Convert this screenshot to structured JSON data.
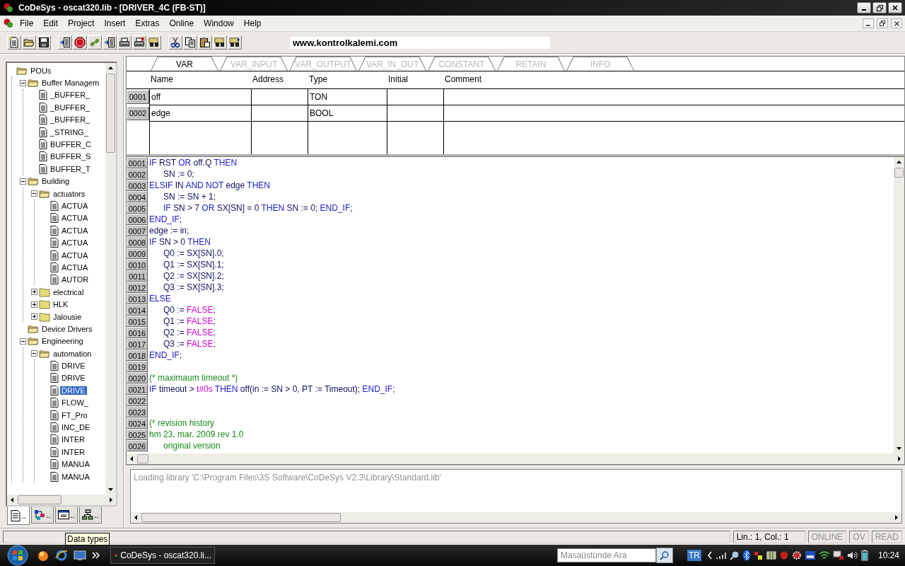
{
  "window": {
    "title": "CoDeSys - oscat320.lib - [DRIVER_4C (FB-ST)]"
  },
  "menu": [
    "File",
    "Edit",
    "Project",
    "Insert",
    "Extras",
    "Online",
    "Window",
    "Help"
  ],
  "toolbar": {
    "banner": "www.kontrolkalemi.com"
  },
  "tree": [
    {
      "label": "POUs",
      "kind": "folder",
      "selected": false,
      "children": [
        {
          "label": "Buffer Managem",
          "kind": "folder",
          "expanded": true,
          "selected": false,
          "children": [
            {
              "label": "_BUFFER_",
              "kind": "doc",
              "selected": false
            },
            {
              "label": "_BUFFER_",
              "kind": "doc",
              "selected": false
            },
            {
              "label": "_BUFFER_",
              "kind": "doc",
              "selected": false
            },
            {
              "label": "_STRING_",
              "kind": "doc",
              "selected": false
            },
            {
              "label": "BUFFER_C",
              "kind": "doc",
              "selected": false
            },
            {
              "label": "BUFFER_S",
              "kind": "doc",
              "selected": false
            },
            {
              "label": "BUFFER_T",
              "kind": "doc",
              "selected": false
            }
          ]
        },
        {
          "label": "Building",
          "kind": "folder",
          "expanded": true,
          "selected": false,
          "children": [
            {
              "label": "actuators",
              "kind": "folder",
              "expanded": true,
              "selected": false,
              "children": [
                {
                  "label": "ACTUA",
                  "kind": "doc",
                  "selected": false
                },
                {
                  "label": "ACTUA",
                  "kind": "doc",
                  "selected": false
                },
                {
                  "label": "ACTUA",
                  "kind": "doc",
                  "selected": false
                },
                {
                  "label": "ACTUA",
                  "kind": "doc",
                  "selected": false
                },
                {
                  "label": "ACTUA",
                  "kind": "doc",
                  "selected": false
                },
                {
                  "label": "ACTUA",
                  "kind": "doc",
                  "selected": false
                },
                {
                  "label": "AUTOR",
                  "kind": "doc",
                  "selected": false
                }
              ]
            },
            {
              "label": "electrical",
              "kind": "folder",
              "expanded": false,
              "selected": false
            },
            {
              "label": "HLK",
              "kind": "folder",
              "expanded": false,
              "selected": false
            },
            {
              "label": "Jalousie",
              "kind": "folder",
              "expanded": false,
              "selected": false
            }
          ]
        },
        {
          "label": "Device Drivers",
          "kind": "folder",
          "selected": false
        },
        {
          "label": "Engineering",
          "kind": "folder",
          "expanded": true,
          "selected": false,
          "children": [
            {
              "label": "automation",
              "kind": "folder",
              "expanded": true,
              "selected": false,
              "children": [
                {
                  "label": "DRIVE",
                  "kind": "doc",
                  "selected": false
                },
                {
                  "label": "DRIVE",
                  "kind": "doc",
                  "selected": false
                },
                {
                  "label": "DRIVE",
                  "kind": "doc",
                  "selected": true
                },
                {
                  "label": "FLOW_",
                  "kind": "doc",
                  "selected": false
                },
                {
                  "label": "FT_Pro",
                  "kind": "doc",
                  "selected": false
                },
                {
                  "label": "INC_DE",
                  "kind": "doc",
                  "selected": false
                },
                {
                  "label": "INTER",
                  "kind": "doc",
                  "selected": false
                },
                {
                  "label": "INTER",
                  "kind": "doc",
                  "selected": false
                },
                {
                  "label": "MANUA",
                  "kind": "doc",
                  "selected": false
                },
                {
                  "label": "MANUA",
                  "kind": "doc",
                  "selected": false
                }
              ]
            }
          ]
        }
      ]
    }
  ],
  "tree_tabs": [
    {
      "label": "..",
      "selected": true
    },
    {
      "label": "..",
      "selected": false
    },
    {
      "label": "..",
      "selected": false
    },
    {
      "label": "..",
      "selected": false
    }
  ],
  "tooltip": "Data types",
  "var_tabs": [
    {
      "label": "VAR",
      "selected": true
    },
    {
      "label": "VAR_INPUT",
      "selected": false
    },
    {
      "label": "VAR_OUTPUT",
      "selected": false
    },
    {
      "label": "VAR_IN_OUT",
      "selected": false
    },
    {
      "label": "CONSTANT",
      "selected": false
    },
    {
      "label": "RETAIN",
      "selected": false
    },
    {
      "label": "INFO",
      "selected": false
    }
  ],
  "var_table": {
    "columns": [
      "Name",
      "Address",
      "Type",
      "Initial",
      "Comment"
    ],
    "rows": [
      {
        "line": "0001",
        "name": "off",
        "type": "TON"
      },
      {
        "line": "0002",
        "name": "edge",
        "type": "BOOL"
      }
    ]
  },
  "code": [
    {
      "line": "0001",
      "indented": false,
      "parts": [
        {
          "kind": "kw",
          "t": "IF"
        },
        {
          "kind": "id",
          "t": " RST "
        },
        {
          "kind": "kw",
          "t": "OR"
        },
        {
          "kind": "id",
          "t": " off.Q "
        },
        {
          "kind": "kw",
          "t": "THEN"
        }
      ]
    },
    {
      "line": "0002",
      "indented": true,
      "parts": [
        {
          "kind": "id",
          "t": "SN := 0;"
        }
      ]
    },
    {
      "line": "0003",
      "indented": false,
      "parts": [
        {
          "kind": "kw",
          "t": "ELSIF"
        },
        {
          "kind": "id",
          "t": " IN "
        },
        {
          "kind": "kw",
          "t": "AND NOT"
        },
        {
          "kind": "id",
          "t": " edge "
        },
        {
          "kind": "kw",
          "t": "THEN"
        }
      ]
    },
    {
      "line": "0004",
      "indented": true,
      "parts": [
        {
          "kind": "id",
          "t": "SN := SN + 1;"
        }
      ]
    },
    {
      "line": "0005",
      "indented": true,
      "parts": [
        {
          "kind": "kw",
          "t": "IF"
        },
        {
          "kind": "id",
          "t": " SN > 7 "
        },
        {
          "kind": "kw",
          "t": "OR"
        },
        {
          "kind": "id",
          "t": " SX[SN] = 0 "
        },
        {
          "kind": "kw",
          "t": "THEN"
        },
        {
          "kind": "id",
          "t": " SN := 0; "
        },
        {
          "kind": "kw",
          "t": "END_IF"
        },
        {
          "kind": "id",
          "t": ";"
        }
      ]
    },
    {
      "line": "0006",
      "indented": false,
      "parts": [
        {
          "kind": "kw",
          "t": "END_IF"
        },
        {
          "kind": "id",
          "t": ";"
        }
      ]
    },
    {
      "line": "0007",
      "indented": false,
      "parts": [
        {
          "kind": "id",
          "t": "edge := in;"
        }
      ]
    },
    {
      "line": "0008",
      "indented": false,
      "parts": [
        {
          "kind": "kw",
          "t": "IF"
        },
        {
          "kind": "id",
          "t": " SN > 0 "
        },
        {
          "kind": "kw",
          "t": "THEN"
        }
      ]
    },
    {
      "line": "0009",
      "indented": true,
      "parts": [
        {
          "kind": "id",
          "t": "Q0 := SX[SN].0;"
        }
      ]
    },
    {
      "line": "0010",
      "indented": true,
      "parts": [
        {
          "kind": "id",
          "t": "Q1 := SX[SN].1;"
        }
      ]
    },
    {
      "line": "0011",
      "indented": true,
      "parts": [
        {
          "kind": "id",
          "t": "Q2 := SX[SN].2;"
        }
      ]
    },
    {
      "line": "0012",
      "indented": true,
      "parts": [
        {
          "kind": "id",
          "t": "Q3 := SX[SN].3;"
        }
      ]
    },
    {
      "line": "0013",
      "indented": false,
      "parts": [
        {
          "kind": "kw",
          "t": "ELSE"
        }
      ]
    },
    {
      "line": "0014",
      "indented": true,
      "parts": [
        {
          "kind": "id",
          "t": "Q0 := "
        },
        {
          "kind": "lit",
          "t": "FALSE"
        },
        {
          "kind": "id",
          "t": ";"
        }
      ]
    },
    {
      "line": "0015",
      "indented": true,
      "parts": [
        {
          "kind": "id",
          "t": "Q1 := "
        },
        {
          "kind": "lit",
          "t": "FALSE"
        },
        {
          "kind": "id",
          "t": ";"
        }
      ]
    },
    {
      "line": "0016",
      "indented": true,
      "parts": [
        {
          "kind": "id",
          "t": "Q2 := "
        },
        {
          "kind": "lit",
          "t": "FALSE"
        },
        {
          "kind": "id",
          "t": ";"
        }
      ]
    },
    {
      "line": "0017",
      "indented": true,
      "parts": [
        {
          "kind": "id",
          "t": "Q3 := "
        },
        {
          "kind": "lit",
          "t": "FALSE"
        },
        {
          "kind": "id",
          "t": ";"
        }
      ]
    },
    {
      "line": "0018",
      "indented": false,
      "parts": [
        {
          "kind": "kw",
          "t": "END_IF"
        },
        {
          "kind": "id",
          "t": ";"
        }
      ]
    },
    {
      "line": "0019"
    },
    {
      "line": "0020",
      "indented": false,
      "parts": [
        {
          "kind": "comment",
          "t": "(* maximaum timeout *)"
        }
      ]
    },
    {
      "line": "0021",
      "indented": false,
      "parts": [
        {
          "kind": "kw",
          "t": "IF"
        },
        {
          "kind": "id",
          "t": " timeout > "
        },
        {
          "kind": "lit",
          "t": "t#0s"
        },
        {
          "kind": "kw",
          "t": " THEN"
        },
        {
          "kind": "id",
          "t": " off(in := SN > 0, PT := Timeout); "
        },
        {
          "kind": "kw",
          "t": "END_IF"
        },
        {
          "kind": "id",
          "t": ";"
        }
      ]
    },
    {
      "line": "0022"
    },
    {
      "line": "0023"
    },
    {
      "line": "0024",
      "indented": false,
      "parts": [
        {
          "kind": "comment",
          "t": "(* revision history"
        }
      ]
    },
    {
      "line": "0025",
      "indented": false,
      "parts": [
        {
          "kind": "comment",
          "t": "hm 23. mar. 2009 rev 1.0"
        }
      ]
    },
    {
      "line": "0026",
      "indented": true,
      "parts": [
        {
          "kind": "comment",
          "t": "original version"
        }
      ]
    }
  ],
  "messages": [
    "Loading library 'C:\\Program Files\\3S Software\\CoDeSys V2.3\\Library\\Standard.lib'"
  ],
  "status_bar": {
    "position": "Lin.: 1, Col.: 1",
    "indicators": [
      {
        "label": "ONLINE",
        "active": false
      },
      {
        "label": "OV",
        "active": false
      },
      {
        "label": "READ",
        "active": false
      }
    ]
  },
  "taskbar": {
    "task": "CoDeSys - oscat320.li...",
    "search_placeholder": "Masaüstünde Ara",
    "language": "TR",
    "clock": "10:24"
  }
}
